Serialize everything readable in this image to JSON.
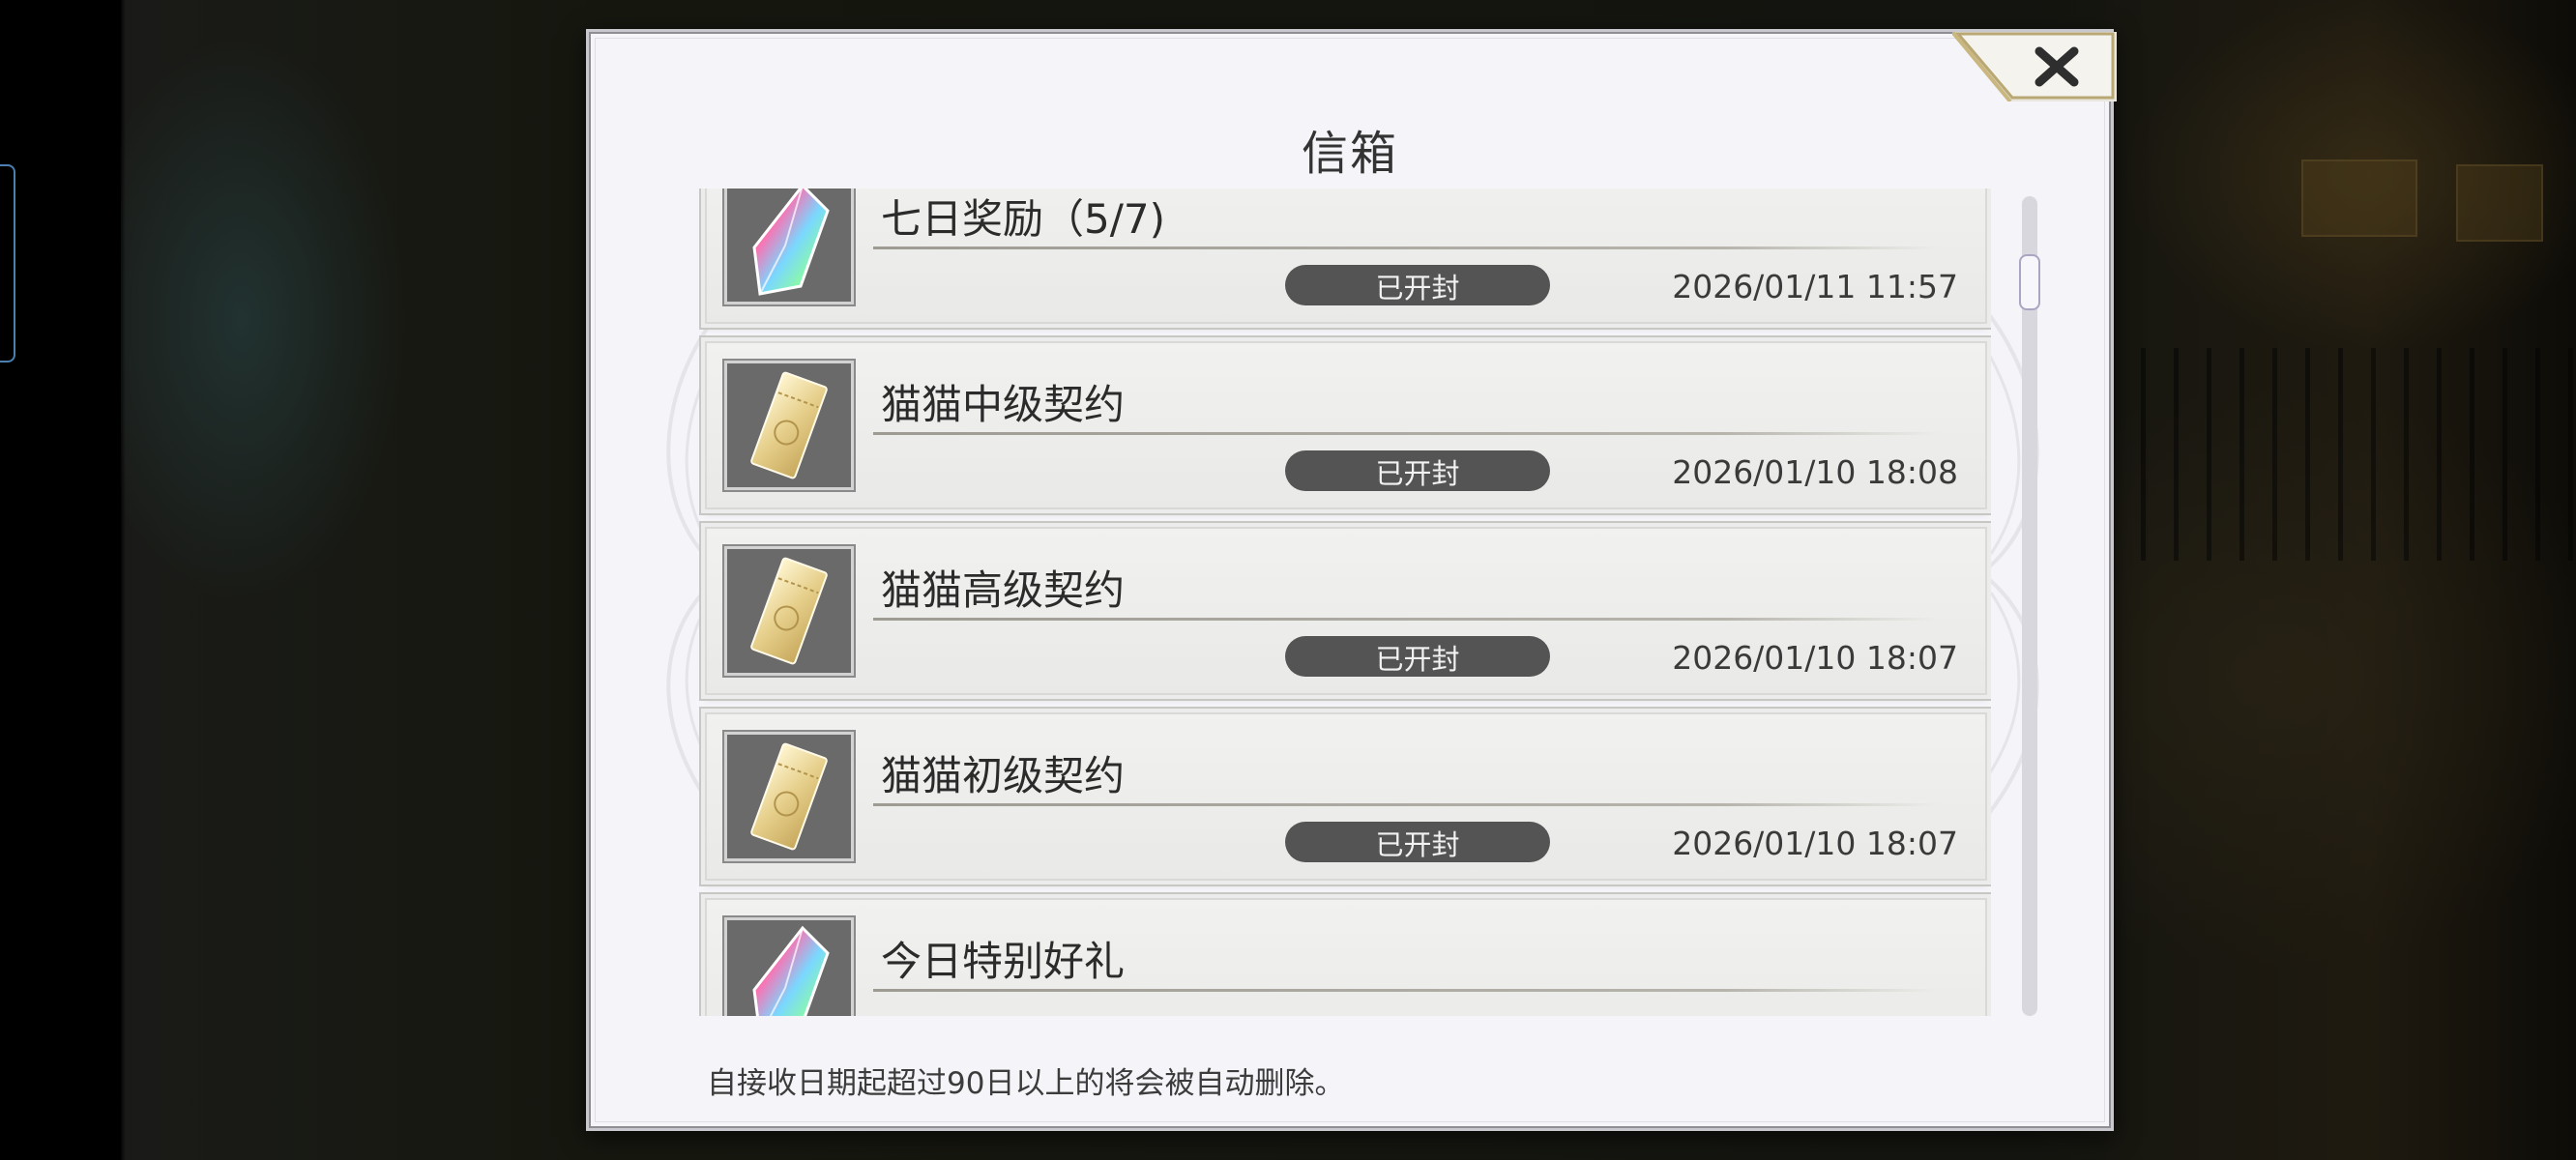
{
  "dialog": {
    "title": "信箱",
    "close_icon": "close-icon",
    "footer_note": "自接收日期起超过90日以上的将会被自动删除。"
  },
  "mails": [
    {
      "title": "七日奖励（5/7)",
      "status": "已开封",
      "date": "2026/01/11 11:57",
      "icon": "crystal-icon"
    },
    {
      "title": "猫猫中级契约",
      "status": "已开封",
      "date": "2026/01/10 18:08",
      "icon": "ticket-icon"
    },
    {
      "title": "猫猫高级契约",
      "status": "已开封",
      "date": "2026/01/10 18:07",
      "icon": "ticket-icon"
    },
    {
      "title": "猫猫初级契约",
      "status": "已开封",
      "date": "2026/01/10 18:07",
      "icon": "ticket-icon"
    },
    {
      "title": "今日特别好礼",
      "status": "",
      "date": "",
      "icon": "crystal-icon"
    }
  ],
  "colors": {
    "dialog_bg": "#f5f4f8",
    "badge_bg": "#545454",
    "scroll_thumb_border": "#a9a6c2"
  }
}
